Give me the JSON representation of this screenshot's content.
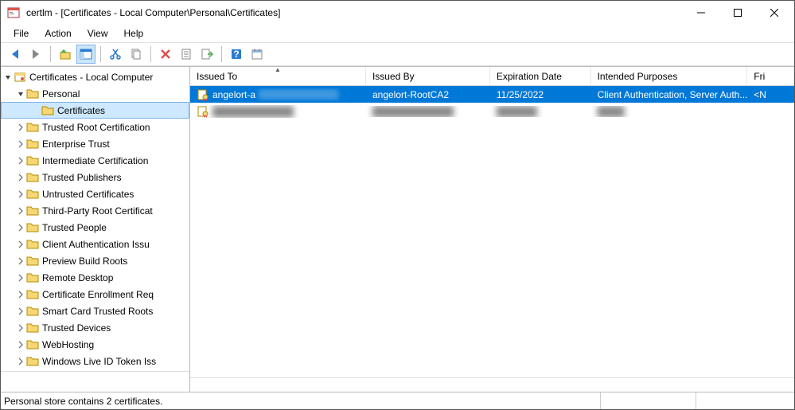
{
  "window": {
    "title": "certlm - [Certificates - Local Computer\\Personal\\Certificates]"
  },
  "menu": {
    "file": "File",
    "action": "Action",
    "view": "View",
    "help": "Help"
  },
  "tree": {
    "root": "Certificates - Local Computer",
    "personal": "Personal",
    "certificates": "Certificates",
    "nodes": [
      "Trusted Root Certification",
      "Enterprise Trust",
      "Intermediate Certification",
      "Trusted Publishers",
      "Untrusted Certificates",
      "Third-Party Root Certificat",
      "Trusted People",
      "Client Authentication Issu",
      "Preview Build Roots",
      "Remote Desktop",
      "Certificate Enrollment Req",
      "Smart Card Trusted Roots",
      "Trusted Devices",
      "WebHosting",
      "Windows Live ID Token Iss"
    ]
  },
  "columns": {
    "issued_to": "Issued To",
    "issued_by": "Issued By",
    "expiration": "Expiration Date",
    "purposes": "Intended Purposes",
    "friendly": "Fri"
  },
  "rows": [
    {
      "issued_to": "angelort-a",
      "issued_by": "angelort-RootCA2",
      "expiration": "11/25/2022",
      "purposes": "Client Authentication, Server Auth...",
      "friendly": "<N"
    },
    {
      "issued_to": "████████████",
      "issued_by": "████████████",
      "expiration": "██████",
      "purposes": "████",
      "friendly": ""
    }
  ],
  "status": "Personal store contains 2 certificates."
}
